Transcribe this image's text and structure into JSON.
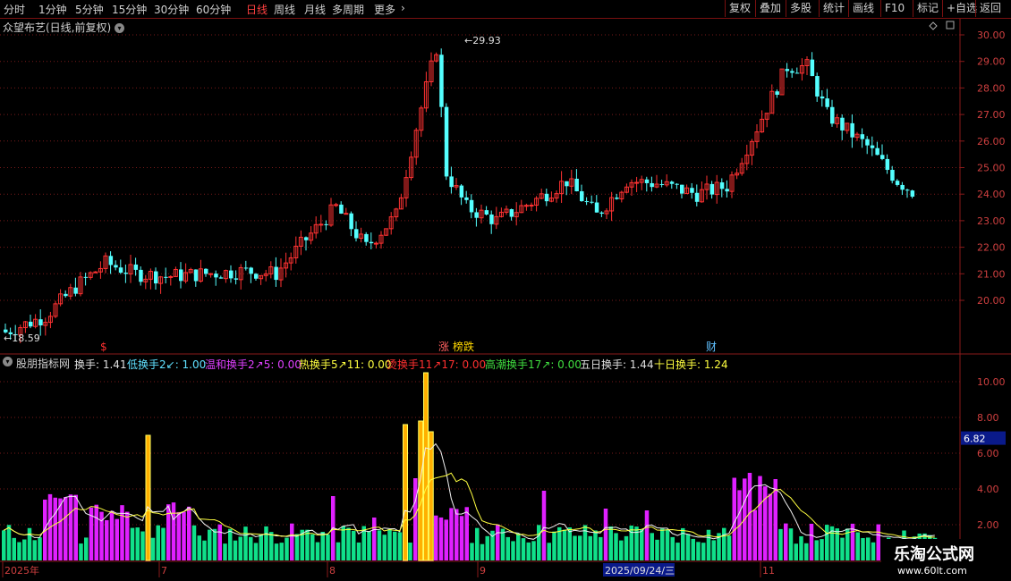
{
  "toolbar": {
    "periods": [
      "分时",
      "1分钟",
      "5分钟",
      "15分钟",
      "30分钟",
      "60分钟",
      "日线",
      "周线",
      "月线",
      "多周期",
      "更多"
    ],
    "active_period": "日线",
    "right_buttons": [
      "复权",
      "叠加",
      "多股",
      "统计",
      "画线",
      "F10",
      "+自选",
      "返回"
    ],
    "mark_label": "标记"
  },
  "main_chart": {
    "title": "众望布艺(日线,前复权)",
    "high_label": "29.93",
    "low_label": "18.59",
    "y_ticks": [
      "30.00",
      "29.00",
      "28.00",
      "27.00",
      "26.00",
      "25.00",
      "24.00",
      "23.00",
      "22.00",
      "21.00",
      "20.00"
    ],
    "markers": [
      {
        "text": "$",
        "color": "#ff3030"
      },
      {
        "text": "涨",
        "color": "#ff6060"
      },
      {
        "text": "榜跌",
        "color": "#ffd700"
      },
      {
        "text": "财",
        "color": "#60c0ff"
      }
    ]
  },
  "indicator": {
    "name": "股朋指标网",
    "items": [
      {
        "label": "换手: 1.41",
        "color": "#e0e0e0"
      },
      {
        "label": "低换手2↙: 1.00",
        "color": "#60e0ff"
      },
      {
        "label": "温和换手2↗5: 0.00",
        "color": "#e040ff"
      },
      {
        "label": "热换手5↗11: 0.00",
        "color": "#ffff40"
      },
      {
        "label": "烫换手11↗17: 0.00",
        "color": "#ff3030"
      },
      {
        "label": "高潮换手17↗: 0.00",
        "color": "#40e040"
      },
      {
        "label": "五日换手: 1.44",
        "color": "#e0e0e0"
      },
      {
        "label": "十日换手: 1.24",
        "color": "#ffff40"
      }
    ],
    "y_ticks": [
      "10.00",
      "8.00",
      "6.00",
      "4.00",
      "2.00"
    ],
    "current_value": "6.82"
  },
  "time_axis": {
    "labels": [
      "2025年",
      "7",
      "8",
      "9",
      "11"
    ],
    "cursor_date": "2025/09/24/三"
  },
  "watermark": {
    "line1": "乐淘公式网",
    "line2": "www.60lt.com"
  },
  "colors": {
    "up": "#ff3232",
    "down": "#54ffff",
    "grid": "#781a1a",
    "bg": "#000000"
  }
}
